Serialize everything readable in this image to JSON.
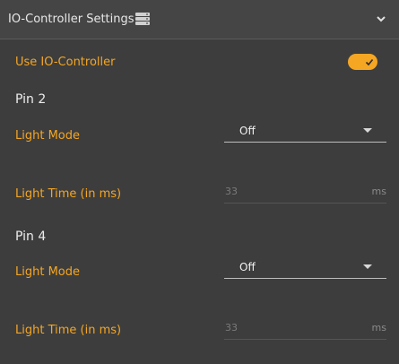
{
  "header": {
    "title": "IO-Controller Settings",
    "icon": "server-icon",
    "chevron": "chevron-down-icon"
  },
  "use_io_controller": {
    "label": "Use IO-Controller",
    "enabled": true
  },
  "pins": [
    {
      "title": "Pin 2",
      "light_mode_label": "Light Mode",
      "light_mode_value": "Off",
      "light_time_label": "Light Time (in ms)",
      "light_time_value": "33",
      "light_time_unit": "ms"
    },
    {
      "title": "Pin 4",
      "light_mode_label": "Light Mode",
      "light_mode_value": "Off",
      "light_time_label": "Light Time (in ms)",
      "light_time_value": "33",
      "light_time_unit": "ms"
    }
  ],
  "colors": {
    "accent": "#f5a623",
    "background": "#3d3d3d",
    "header_background": "#454545"
  }
}
